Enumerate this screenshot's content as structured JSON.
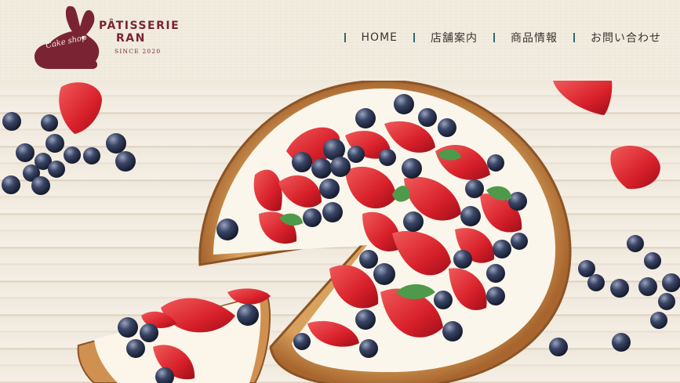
{
  "brand": {
    "line1": "PÂTISSERIE",
    "line2": "RAN",
    "since": "SINCE 2020",
    "cake_shop": "Cake shop"
  },
  "nav": {
    "items": [
      {
        "label": "HOME"
      },
      {
        "label": "店舗案内"
      },
      {
        "label": "商品情報"
      },
      {
        "label": "お問い合わせ"
      }
    ]
  },
  "colors": {
    "brand": "#7a2433",
    "nav_separator": "#2f6b6e",
    "nav_text": "#3c3232",
    "header_bg": "#f1ecdf"
  },
  "hero": {
    "image_subject": "berry-tart-photo"
  }
}
